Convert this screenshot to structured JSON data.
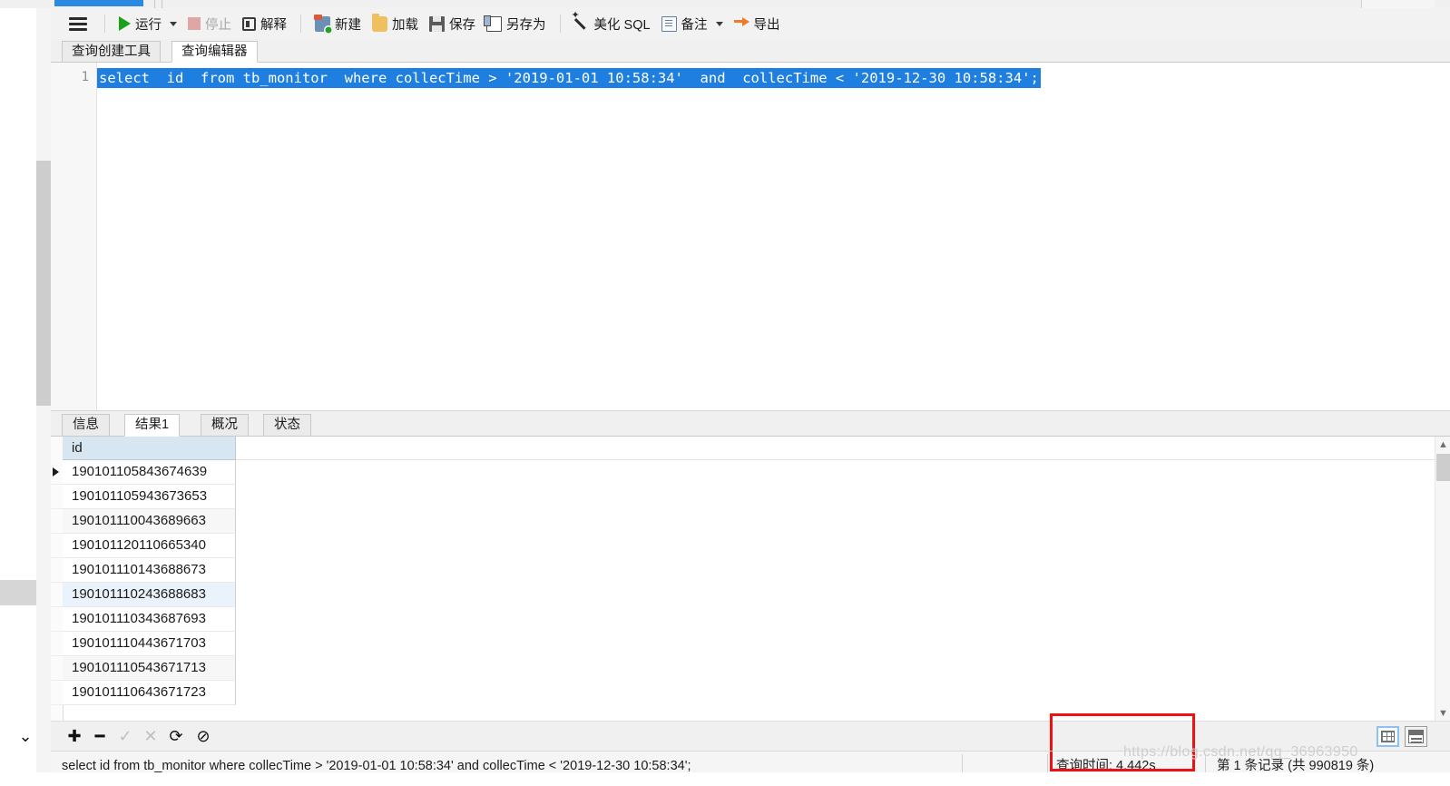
{
  "toolbar": {
    "menu_icon": "hamburger-icon",
    "items": [
      {
        "id": "run",
        "label": "运行",
        "icon": "play-icon",
        "has_caret": true,
        "disabled": false
      },
      {
        "id": "stop",
        "label": "停止",
        "icon": "stop-icon",
        "has_caret": false,
        "disabled": true
      },
      {
        "id": "explain",
        "label": "解释",
        "icon": "explain-icon",
        "has_caret": false,
        "disabled": false
      },
      {
        "id": "new",
        "label": "新建",
        "icon": "new-file-icon",
        "has_caret": false,
        "disabled": false
      },
      {
        "id": "load",
        "label": "加载",
        "icon": "folder-icon",
        "has_caret": false,
        "disabled": false
      },
      {
        "id": "save",
        "label": "保存",
        "icon": "save-icon",
        "has_caret": false,
        "disabled": false
      },
      {
        "id": "saveas",
        "label": "另存为",
        "icon": "save-as-icon",
        "has_caret": false,
        "disabled": false
      },
      {
        "id": "beautify",
        "label": "美化 SQL",
        "icon": "magic-wand-icon",
        "has_caret": false,
        "disabled": false
      },
      {
        "id": "note",
        "label": "备注",
        "icon": "note-icon",
        "has_caret": true,
        "disabled": false
      },
      {
        "id": "export",
        "label": "导出",
        "icon": "export-icon",
        "has_caret": false,
        "disabled": false
      }
    ]
  },
  "editor_tabs": [
    {
      "label": "查询创建工具",
      "active": false
    },
    {
      "label": "查询编辑器",
      "active": true
    }
  ],
  "editor": {
    "line_number": "1",
    "sql": "select  id  from tb_monitor  where collecTime > '2019-01-01 10:58:34'  and  collecTime < '2019-12-30 10:58:34';",
    "selection_color": "#1e7fe0",
    "selected": true
  },
  "result_tabs": [
    {
      "label": "信息",
      "active": false
    },
    {
      "label": "结果1",
      "active": true
    },
    {
      "label": "概况",
      "active": false
    },
    {
      "label": "状态",
      "active": false
    }
  ],
  "grid": {
    "columns": [
      "id"
    ],
    "rows": [
      {
        "id": "190101105843674639",
        "current": true,
        "style": "normal"
      },
      {
        "id": "190101105943673653",
        "current": false,
        "style": "normal"
      },
      {
        "id": "190101110043689663",
        "current": false,
        "style": "alt"
      },
      {
        "id": "190101120110665340",
        "current": false,
        "style": "normal"
      },
      {
        "id": "190101110143688673",
        "current": false,
        "style": "normal"
      },
      {
        "id": "190101110243688683",
        "current": false,
        "style": "sel"
      },
      {
        "id": "190101110343687693",
        "current": false,
        "style": "normal"
      },
      {
        "id": "190101110443671703",
        "current": false,
        "style": "normal"
      },
      {
        "id": "190101110543671713",
        "current": false,
        "style": "alt"
      },
      {
        "id": "190101110643671723",
        "current": false,
        "style": "normal"
      }
    ]
  },
  "nav": {
    "icons": [
      {
        "id": "collapse",
        "glyph": "⌄",
        "name": "chevron-down-icon",
        "disabled": false
      },
      {
        "id": "add",
        "glyph": "✚",
        "name": "add-record-icon",
        "disabled": false
      },
      {
        "id": "remove",
        "glyph": "━",
        "name": "remove-record-icon",
        "disabled": false
      },
      {
        "id": "apply",
        "glyph": "✓",
        "name": "apply-changes-icon",
        "disabled": true
      },
      {
        "id": "cancel",
        "glyph": "✕",
        "name": "cancel-changes-icon",
        "disabled": true
      },
      {
        "id": "refresh",
        "glyph": "⟳",
        "name": "refresh-icon",
        "disabled": false
      },
      {
        "id": "stop",
        "glyph": "⊘",
        "name": "stop-loading-icon",
        "disabled": false
      }
    ],
    "view_buttons": [
      {
        "id": "grid-view",
        "name": "grid-view-icon",
        "active": true
      },
      {
        "id": "form-view",
        "name": "form-view-icon",
        "active": false
      }
    ]
  },
  "status": {
    "sql": "select  id  from tb_monitor  where collecTime > '2019-01-01 10:58:34'  and  collecTime < '2019-12-30 10:58:34';",
    "query_time": "查询时间: 4.442s",
    "record_info": "第 1 条记录 (共 990819 条)",
    "watermark": "https://blog.csdn.net/qq_36963950"
  },
  "colors": {
    "selection_blue": "#1e7fe0",
    "header_blue": "#d8e6f2",
    "annotation_red": "#ee1111",
    "accent_tab_blue": "#2b8ae0"
  }
}
